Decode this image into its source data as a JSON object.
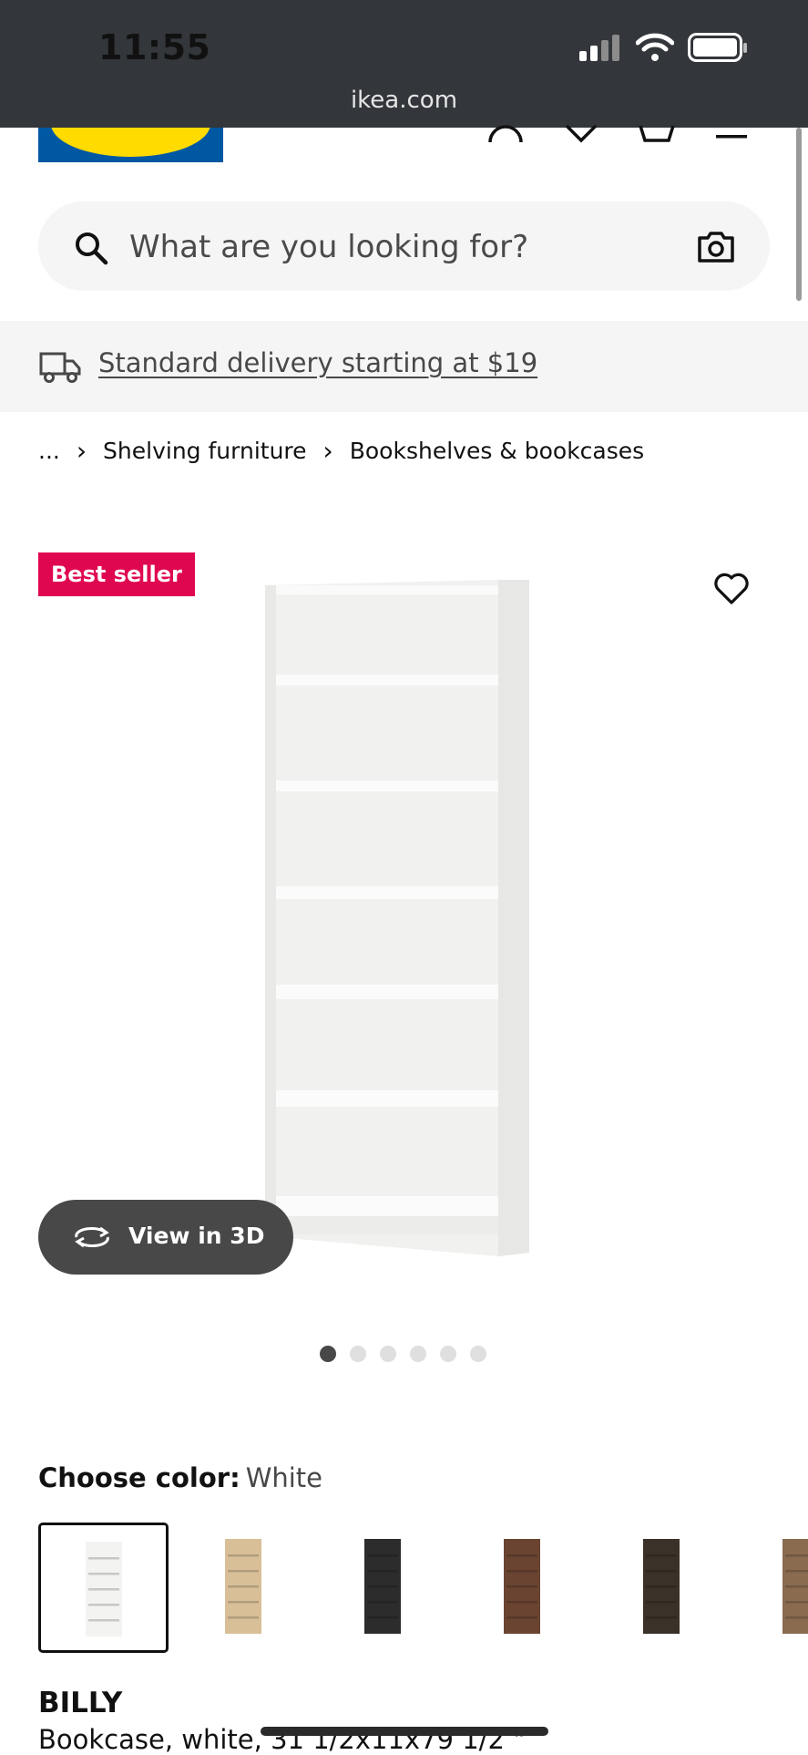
{
  "status_bar": {
    "time": "11:55",
    "url": "ikea.com"
  },
  "search": {
    "placeholder": "What are you looking for?"
  },
  "delivery": {
    "text": "Standard delivery starting at $19"
  },
  "breadcrumb": {
    "ellipsis": "...",
    "items": [
      "Shelving furniture",
      "Bookshelves & bookcases"
    ]
  },
  "product": {
    "badge": "Best seller",
    "view3d_label": "View in 3D",
    "carousel": {
      "total": 6,
      "active_index": 1
    },
    "choose_color_label": "Choose color:",
    "color_value": "White",
    "color_swatches": [
      {
        "name": "white",
        "color": "#f3f3f1",
        "selected": true
      },
      {
        "name": "oak",
        "color": "#d8bf98"
      },
      {
        "name": "black",
        "color": "#2c2c2c"
      },
      {
        "name": "walnut",
        "color": "#6a4431"
      },
      {
        "name": "dark-brown",
        "color": "#3a3128"
      },
      {
        "name": "partial",
        "color": "#8a6b50"
      }
    ],
    "name": "BILLY",
    "description": "Bookcase, white, 31 1/2x11x79 1/2 \""
  },
  "colors": {
    "brand_blue": "#0058a3",
    "brand_yellow": "#ffdb00",
    "badge_red": "#e00751"
  }
}
